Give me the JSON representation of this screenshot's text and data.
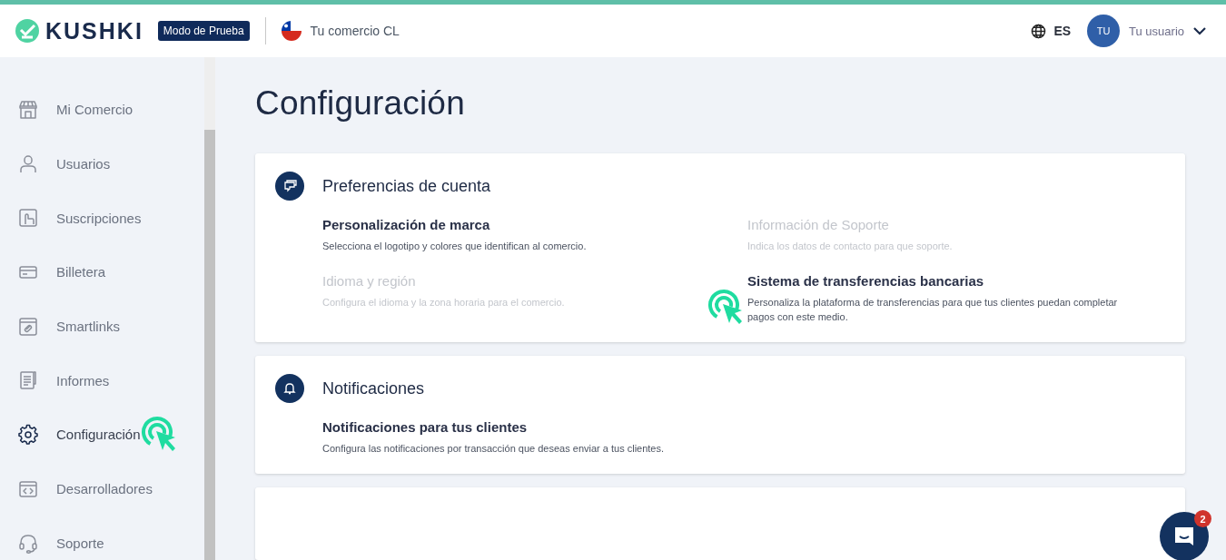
{
  "header": {
    "logo": "KUSHKI",
    "mode_badge": "Modo de Prueba",
    "merchant": "Tu comercio CL",
    "language": "ES",
    "avatar_initials": "TU",
    "user": "Tu usuario"
  },
  "sidebar": {
    "items": [
      {
        "label": "Mi Comercio",
        "selected": false
      },
      {
        "label": "Usuarios",
        "selected": false
      },
      {
        "label": "Suscripciones",
        "selected": false
      },
      {
        "label": "Billetera",
        "selected": false
      },
      {
        "label": "Smartlinks",
        "selected": false
      },
      {
        "label": "Informes",
        "selected": false
      },
      {
        "label": "Configuración",
        "selected": true
      },
      {
        "label": "Desarrolladores",
        "selected": false
      },
      {
        "label": "Soporte",
        "selected": false
      }
    ]
  },
  "page_title": "Configuración",
  "sections": [
    {
      "title": "Preferencias de cuenta",
      "options": [
        {
          "title": "Personalización de marca",
          "description": "Selecciona el logotipo y colores que identifican al comercio.",
          "disabled": false
        },
        {
          "title": "Información de Soporte",
          "description": "Indica los datos de contacto para que soporte.",
          "disabled": true
        },
        {
          "title": "Idioma y región",
          "description": "Configura el idioma y la zona horaria para el comercio.",
          "disabled": true
        },
        {
          "title": "Sistema de transferencias bancarias",
          "description": "Personaliza la plataforma de transferencias para que tus clientes puedan completar pagos con este medio.",
          "disabled": false
        }
      ]
    },
    {
      "title": "Notificaciones",
      "options": [
        {
          "title": "Notificaciones para tus clientes",
          "description": "Configura las notificaciones por transacción que deseas enviar a tus clientes.",
          "disabled": false
        }
      ]
    }
  ],
  "chat": {
    "badge": "2"
  }
}
